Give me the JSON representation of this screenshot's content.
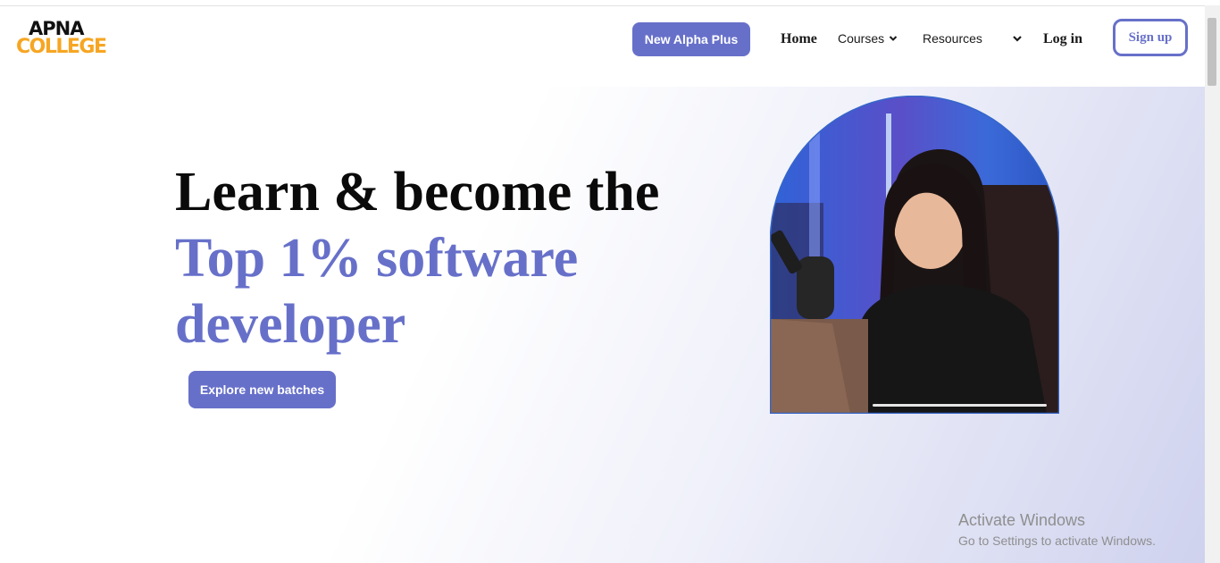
{
  "brand": {
    "logo_line1": "APNA",
    "logo_line2": "COLLEGE",
    "logo_color_top": "#111111",
    "logo_color_bottom": "#f6a623"
  },
  "nav": {
    "alpha_plus": "New Alpha Plus",
    "home": "Home",
    "courses": "Courses",
    "resources": "Resources",
    "login": "Log in",
    "signup": "Sign up",
    "accent_color": "#6770c9"
  },
  "hero": {
    "line1": "Learn & become the",
    "line2": "Top 1% software",
    "line3": "developer",
    "cta": "Explore new batches",
    "image": "woman-at-laptop-photo"
  },
  "watermark": {
    "title": "Activate Windows",
    "subtitle": "Go to Settings to activate Windows."
  }
}
